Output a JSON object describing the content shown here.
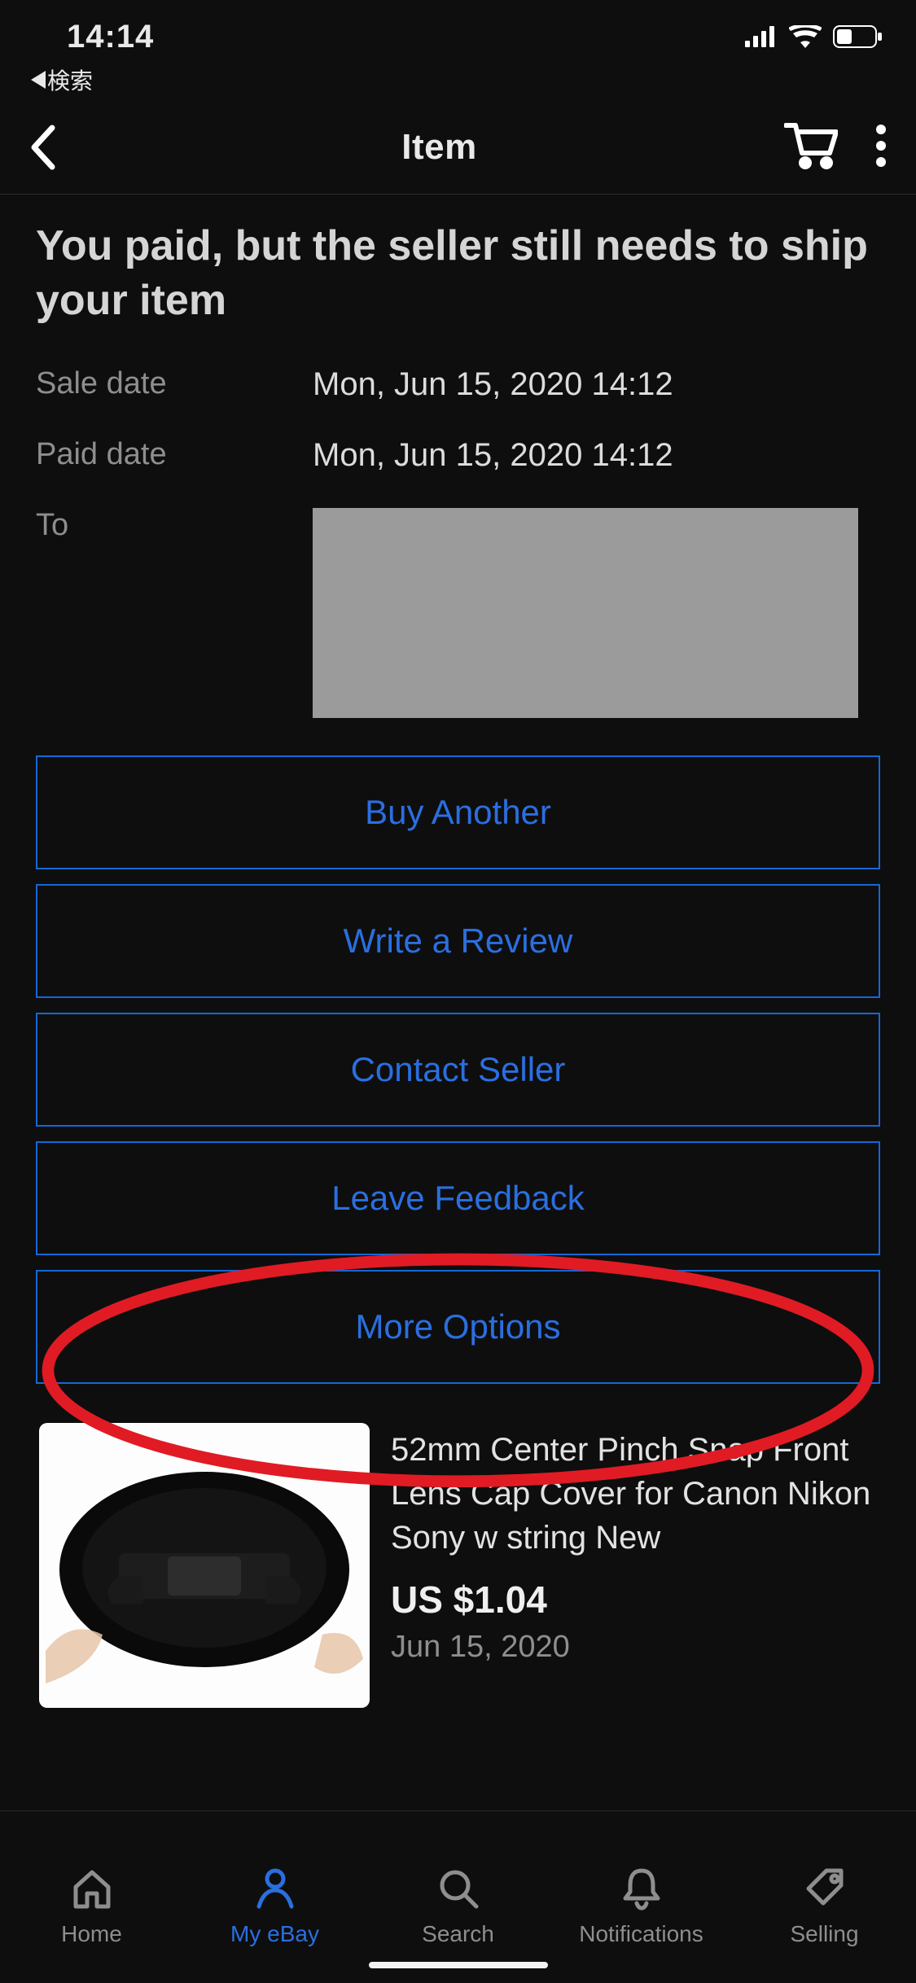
{
  "status": {
    "time": "14:14",
    "back_app_label": "検索"
  },
  "nav": {
    "title": "Item"
  },
  "main": {
    "headline": "You paid, but the seller still needs to ship your item",
    "sale_date_label": "Sale date",
    "sale_date_value": "Mon, Jun 15, 2020 14:12",
    "paid_date_label": "Paid date",
    "paid_date_value": "Mon, Jun 15, 2020 14:12",
    "to_label": "To"
  },
  "actions": {
    "buy_another": "Buy Another",
    "write_review": "Write a Review",
    "contact_seller": "Contact Seller",
    "leave_feedback": "Leave Feedback",
    "more_options": "More Options"
  },
  "item": {
    "title": "52mm Center Pinch Snap Front Lens Cap Cover for Canon Nikon Sony w string New",
    "price": "US $1.04",
    "date": "Jun 15, 2020"
  },
  "tabs": {
    "home": "Home",
    "myebay": "My eBay",
    "search": "Search",
    "notifications": "Notifications",
    "selling": "Selling"
  },
  "annotation": {
    "target": "more_options",
    "color": "#e01b24"
  }
}
